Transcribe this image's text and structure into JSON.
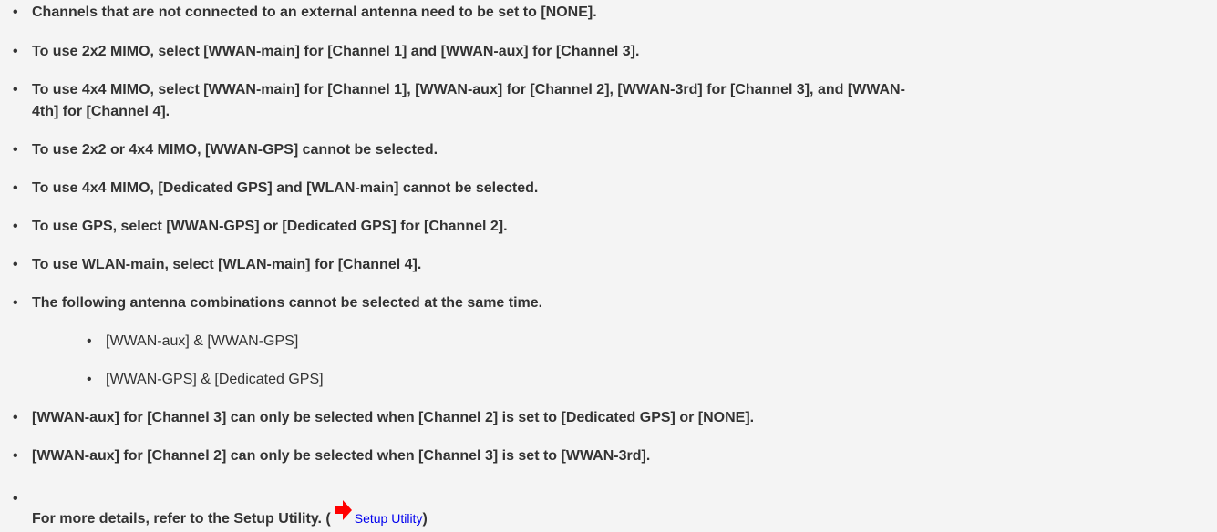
{
  "notes": [
    "Channels that are not connected to an external antenna need to be set to [NONE].",
    "To use 2x2 MIMO, select [WWAN-main] for [Channel 1] and [WWAN-aux] for [Channel 3].",
    "To use 4x4 MIMO, select [WWAN-main] for [Channel 1], [WWAN-aux] for [Channel 2], [WWAN-3rd] for [Channel 3], and [WWAN-",
    "4th] for [Channel 4].",
    "To use 2x2 or 4x4 MIMO, [WWAN-GPS] cannot be selected.",
    "To use 4x4 MIMO, [Dedicated GPS] and [WLAN-main] cannot be selected.",
    "To use GPS, select [WWAN-GPS] or [Dedicated GPS] for [Channel 2].",
    "To use WLAN-main, select [WLAN-main] for [Channel 4].",
    "The following antenna combinations cannot be selected at the same time.",
    "[WWAN-aux] for [Channel 3] can only be selected when [Channel 2] is set to [Dedicated GPS] or [NONE].",
    "[WWAN-aux] for [Channel 2] can only be selected when [Channel 3] is set to [WWAN-3rd]."
  ],
  "combinations": [
    "[WWAN-aux] & [WWAN-GPS]",
    "[WWAN-GPS] & [Dedicated GPS]"
  ],
  "bullet": "•",
  "details": {
    "prefix": "For more details, refer to the Setup Utility. (",
    "link_text": "Setup Utility",
    "suffix": ")",
    "arrow_icon": "red-right-arrow-icon",
    "arrow_color": "#ff0000",
    "link_color": "#0000ee"
  }
}
